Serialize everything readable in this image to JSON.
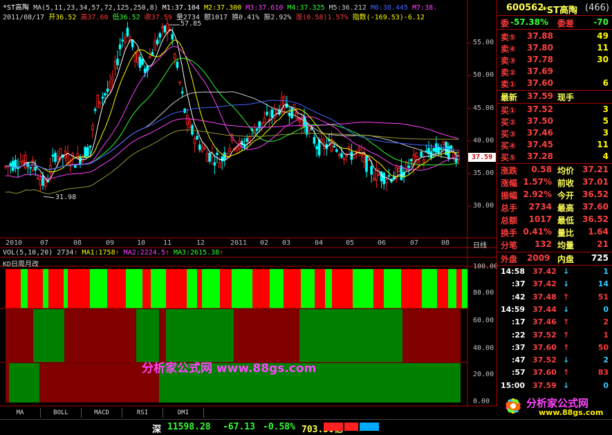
{
  "header": {
    "line1_name": "*ST高陶",
    "line1_ma": "MA(5,11,23,34,57,72,125,250,8)",
    "m1": "M1:37.104",
    "m2": "M2:37.300",
    "m3": "M3:37.610",
    "m4": "M4:37.325",
    "m5": "M5:36.212",
    "m6": "M6:38.445",
    "m7": "M7:38.",
    "date": "2011/08/17",
    "open": "开36.52",
    "high": "高37.60",
    "low": "低36.52",
    "close": "收37.59",
    "vol": "量2734",
    "amt": "额1017",
    "turn": "换0.41%",
    "amp": "振2.92%",
    "chg": "涨(0.58)1.57%",
    "idx": "指数(-169.53)-6.12"
  },
  "chart": {
    "price_ticks": [
      "55.00",
      "50.00",
      "45.00",
      "40.00",
      "35.00",
      "30.00"
    ],
    "current_price_tag": "37.59",
    "high_label": "57.85",
    "low_label": "31.98",
    "dates": [
      "2010",
      "07",
      "08",
      "09",
      "10",
      "11",
      "12",
      "2011",
      "02",
      "03",
      "04",
      "05",
      "06",
      "07",
      "08",
      "日线"
    ],
    "vol_header": "VOL(5,10,20) 2734",
    "vol_ma1": "MA1:1758",
    "vol_ma2": "MA2:2224.5",
    "vol_ma3": "MA3:2615.38",
    "kd_label": "KD日周月改",
    "kd_ticks": [
      "100.00",
      "80.00",
      "60.00",
      "40.00",
      "20.00",
      "0.00"
    ],
    "watermark": "分析家公式网 www.88gs.com",
    "colors": {
      "up": "#ff2020",
      "down": "#00ff00",
      "kd_red": "#ff0000",
      "kd_green": "#00ff00",
      "dark_red": "#800000",
      "dark_green": "#008000"
    }
  },
  "tabs": [
    "MA",
    "BOLL",
    "MACD",
    "RSI",
    "DMI"
  ],
  "quote": {
    "code": "600562",
    "name": "*ST高陶",
    "num": "(466)",
    "weibi_label": "委",
    "weibi": "-57.38%",
    "weicha_label": "委差",
    "weicha": "-70",
    "asks": [
      {
        "label": "卖⑤",
        "price": "37.88",
        "vol": "49"
      },
      {
        "label": "卖④",
        "price": "37.80",
        "vol": "11"
      },
      {
        "label": "卖③",
        "price": "37.78",
        "vol": "30"
      },
      {
        "label": "卖②",
        "price": "37.69",
        "vol": ""
      },
      {
        "label": "卖①",
        "price": "37.60",
        "vol": "6"
      }
    ],
    "last_label": "最新",
    "last": "37.59",
    "xianshou": "现手",
    "bids": [
      {
        "label": "买①",
        "price": "37.52",
        "vol": "3"
      },
      {
        "label": "买②",
        "price": "37.50",
        "vol": "5"
      },
      {
        "label": "买③",
        "price": "37.46",
        "vol": "3"
      },
      {
        "label": "买④",
        "price": "37.45",
        "vol": "11"
      },
      {
        "label": "买⑤",
        "price": "37.28",
        "vol": "4"
      }
    ],
    "stats": [
      {
        "l1": "涨跌",
        "v1": "0.58",
        "l2": "均价",
        "v2": "37.21"
      },
      {
        "l1": "涨幅",
        "v1": "1.57%",
        "l2": "前收",
        "v2": "37.01"
      },
      {
        "l1": "振幅",
        "v1": "2.92%",
        "l2": "今开",
        "v2": "36.52"
      },
      {
        "l1": "总手",
        "v1": "2734",
        "l2": "最高",
        "v2": "37.60"
      },
      {
        "l1": "总额",
        "v1": "1017",
        "l2": "最低",
        "v2": "36.52"
      },
      {
        "l1": "换手",
        "v1": "0.41%",
        "l2": "量比",
        "v2": "1.64"
      },
      {
        "l1": "分笔",
        "v1": "132",
        "l2": "均量",
        "v2": "21"
      }
    ],
    "waipan_label": "外盘",
    "waipan": "2009",
    "neipan_label": "内盘",
    "neipan": "725",
    "ticks": [
      {
        "t": "14:58",
        "p": "37.42",
        "d": "↓",
        "v": "1"
      },
      {
        "t": ":37",
        "p": "37.42",
        "d": "↓",
        "v": "14"
      },
      {
        "t": ":42",
        "p": "37.48",
        "d": "↑",
        "v": "51"
      },
      {
        "t": "14:59",
        "p": "37.44",
        "d": "↓",
        "v": "0"
      },
      {
        "t": ":17",
        "p": "37.46",
        "d": "↑",
        "v": "2"
      },
      {
        "t": ":22",
        "p": "37.52",
        "d": "↑",
        "v": "1"
      },
      {
        "t": ":37",
        "p": "37.60",
        "d": "↑",
        "v": "50"
      },
      {
        "t": ":47",
        "p": "37.52",
        "d": "↓",
        "v": "2"
      },
      {
        "t": ":57",
        "p": "37.60",
        "d": "↑",
        "v": "83"
      },
      {
        "t": "15:00",
        "p": "37.59",
        "d": "↓",
        "v": "0"
      }
    ],
    "logo_text": "分析家公式网",
    "logo_url": "www.88gs.com"
  },
  "status": {
    "market": "深",
    "index": "11598.28",
    "chg": "-67.13",
    "pct": "-0.58%",
    "amt": "703.50亿"
  }
}
